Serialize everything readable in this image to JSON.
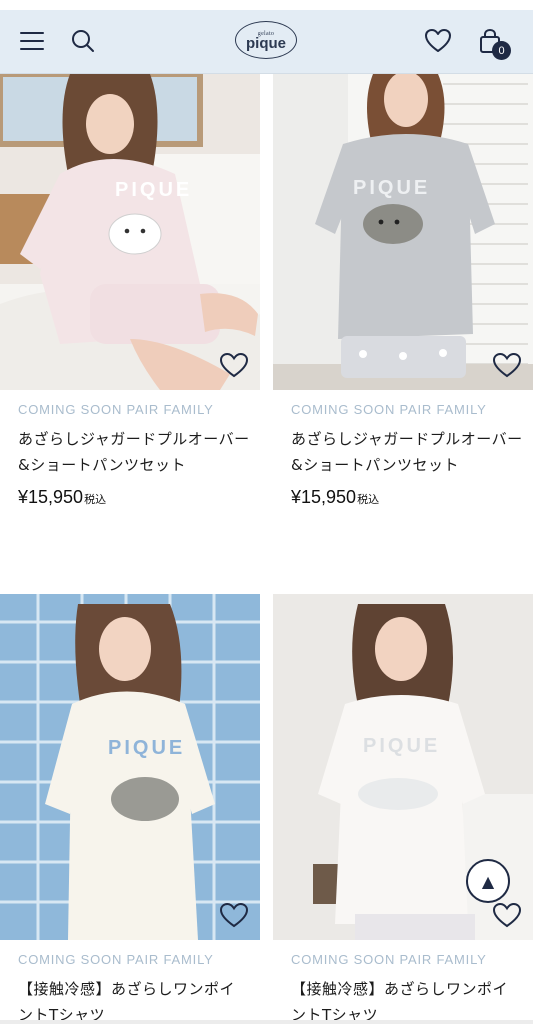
{
  "header": {
    "menu_icon": "hamburger-menu-icon",
    "search_icon": "search-icon",
    "logo_small": "gelato",
    "logo_big": "pique",
    "favorites_icon": "heart-icon",
    "cart_icon": "shopping-bag-icon",
    "cart_count": "0"
  },
  "products": [
    {
      "brand": "COMING SOON PAIR FAMILY",
      "name": "あざらしジャガードプルオーバー&ショートパンツセット",
      "price": "¥15,950",
      "tax": "税込"
    },
    {
      "brand": "COMING SOON PAIR FAMILY",
      "name": "あざらしジャガードプルオーバー&ショートパンツセット",
      "price": "¥15,950",
      "tax": "税込"
    },
    {
      "brand": "COMING SOON PAIR FAMILY",
      "name": "【接触冷感】あざらしワンポイントTシャツ"
    },
    {
      "brand": "COMING SOON PAIR FAMILY",
      "name": "【接触冷感】あざらしワンポイントTシャツ"
    }
  ],
  "photo_print_text": "PIQUE",
  "scroll_top_icon": "arrow-up-icon",
  "colors": {
    "header_bg": "#e3ecf4",
    "navy": "#1f2a44",
    "brand_label": "#a9bccd"
  }
}
